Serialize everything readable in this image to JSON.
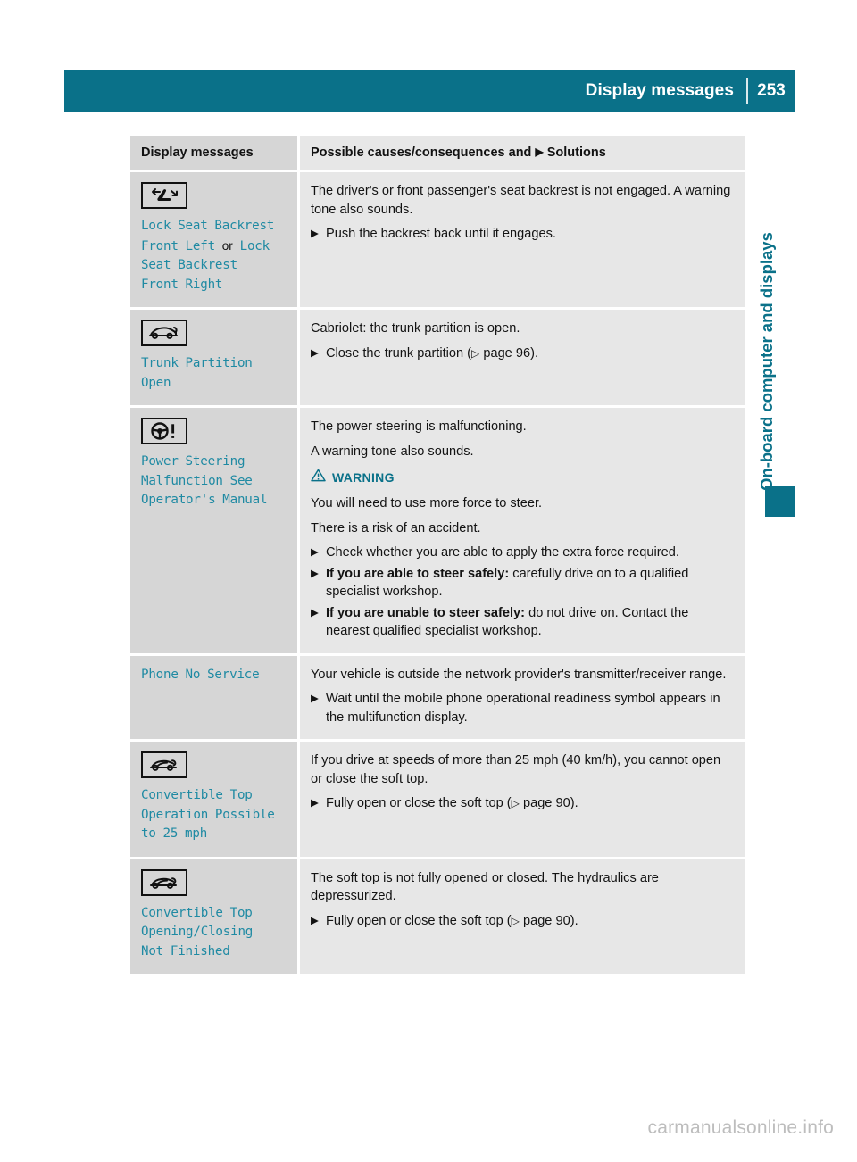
{
  "header": {
    "title": "Display messages",
    "page_number": "253"
  },
  "side_tab": {
    "chapter_label": "On-board computer and displays"
  },
  "table": {
    "columns": {
      "left_header": "Display messages",
      "right_header_before": "Possible causes/consequences and",
      "right_header_arrow": "▶",
      "right_header_after": "Solutions"
    },
    "rows": [
      {
        "icon_name": "seat-backrest-icon",
        "message_line1": "Lock Seat Backrest",
        "message_line2": "Front Left",
        "conjunction": "or",
        "message_line3": "Lock",
        "message_line4": "Seat Backrest",
        "message_line5": "Front Right",
        "paragraphs": [
          "The driver's or front passenger's seat backrest is not engaged. A warning tone also sounds."
        ],
        "steps": [
          {
            "text": "Push the backrest back until it engages."
          }
        ]
      },
      {
        "icon_name": "trunk-partition-icon",
        "message_line1": "Trunk Partition",
        "message_line2": "Open",
        "paragraphs": [
          "Cabriolet: the trunk partition is open."
        ],
        "steps": [
          {
            "text": "Close the trunk partition (",
            "ref_arrow": "▷",
            "ref_text": " page 96).",
            "has_ref": true
          }
        ]
      },
      {
        "icon_name": "power-steering-icon",
        "message_line1": "Power Steering",
        "message_line2": "Malfunction See",
        "message_line3": "Operator's Manual",
        "paragraphs": [
          "The power steering is malfunctioning.",
          "A warning tone also sounds."
        ],
        "warning": {
          "label": "WARNING",
          "icon_name": "warning-triangle-icon",
          "paragraphs": [
            "You will need to use more force to steer.",
            "There is a risk of an accident."
          ],
          "steps": [
            {
              "text": "Check whether you are able to apply the extra force required."
            },
            {
              "bold": "If you are able to steer safely:",
              "text": " carefully drive on to a qualified specialist workshop."
            },
            {
              "bold": "If you are unable to steer safely:",
              "text": " do not drive on. Contact the nearest qualified specialist workshop."
            }
          ]
        }
      },
      {
        "icon_name": null,
        "message_line1": "Phone No Service",
        "paragraphs": [
          "Your vehicle is outside the network provider's transmitter/receiver range."
        ],
        "steps": [
          {
            "text": "Wait until the mobile phone operational readiness symbol appears in the multifunction display."
          }
        ]
      },
      {
        "icon_name": "convertible-top-icon",
        "message_line1": "Convertible Top",
        "message_line2": "Operation Possible",
        "message_line3": "to 25 mph",
        "paragraphs": [
          "If you drive at speeds of more than 25 mph (40 km/h), you cannot open or close the soft top."
        ],
        "steps": [
          {
            "text": "Fully open or close the soft top (",
            "ref_arrow": "▷",
            "ref_text": " page 90).",
            "has_ref": true
          }
        ]
      },
      {
        "icon_name": "convertible-top-icon",
        "message_line1": "Convertible Top",
        "message_line2": "Opening/Closing",
        "message_line3": "Not Finished",
        "paragraphs": [
          "The soft top is not fully opened or closed. The hydraulics are depressurized."
        ],
        "steps": [
          {
            "text": "Fully open or close the soft top (",
            "ref_arrow": "▷",
            "ref_text": " page 90).",
            "has_ref": true
          }
        ]
      }
    ]
  },
  "watermark": "carmanualsonline.info",
  "colors": {
    "teal_header": "#0a7189",
    "teal_message_text": "#1f8aa3",
    "left_cell_bg": "#d6d6d6",
    "right_cell_bg": "#e7e7e7",
    "body_text": "#131313"
  }
}
